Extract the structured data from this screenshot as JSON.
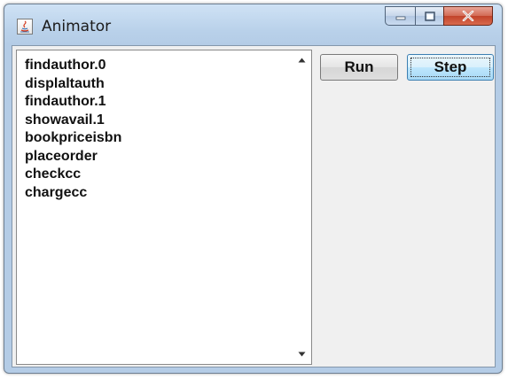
{
  "window": {
    "title": "Animator",
    "app_icon": "java-icon",
    "caption_buttons": [
      "minimize-icon",
      "maximize-icon",
      "close-icon"
    ]
  },
  "list": {
    "items": [
      "findauthor.0",
      "displaltauth",
      "findauthor.1",
      "showavail.1",
      "bookpriceisbn",
      "placeorder",
      "checkcc",
      "chargecc"
    ],
    "scroll_icons": [
      "scroll-up-arrow-icon",
      "scroll-down-arrow-icon"
    ]
  },
  "controls": {
    "run_label": "Run",
    "step_label": "Step"
  },
  "colors": {
    "titlebar": "#b9d1ea",
    "close_button": "#c2432a",
    "client_background": "#f0f0f0",
    "step_button_highlight": "#bee6fd"
  }
}
